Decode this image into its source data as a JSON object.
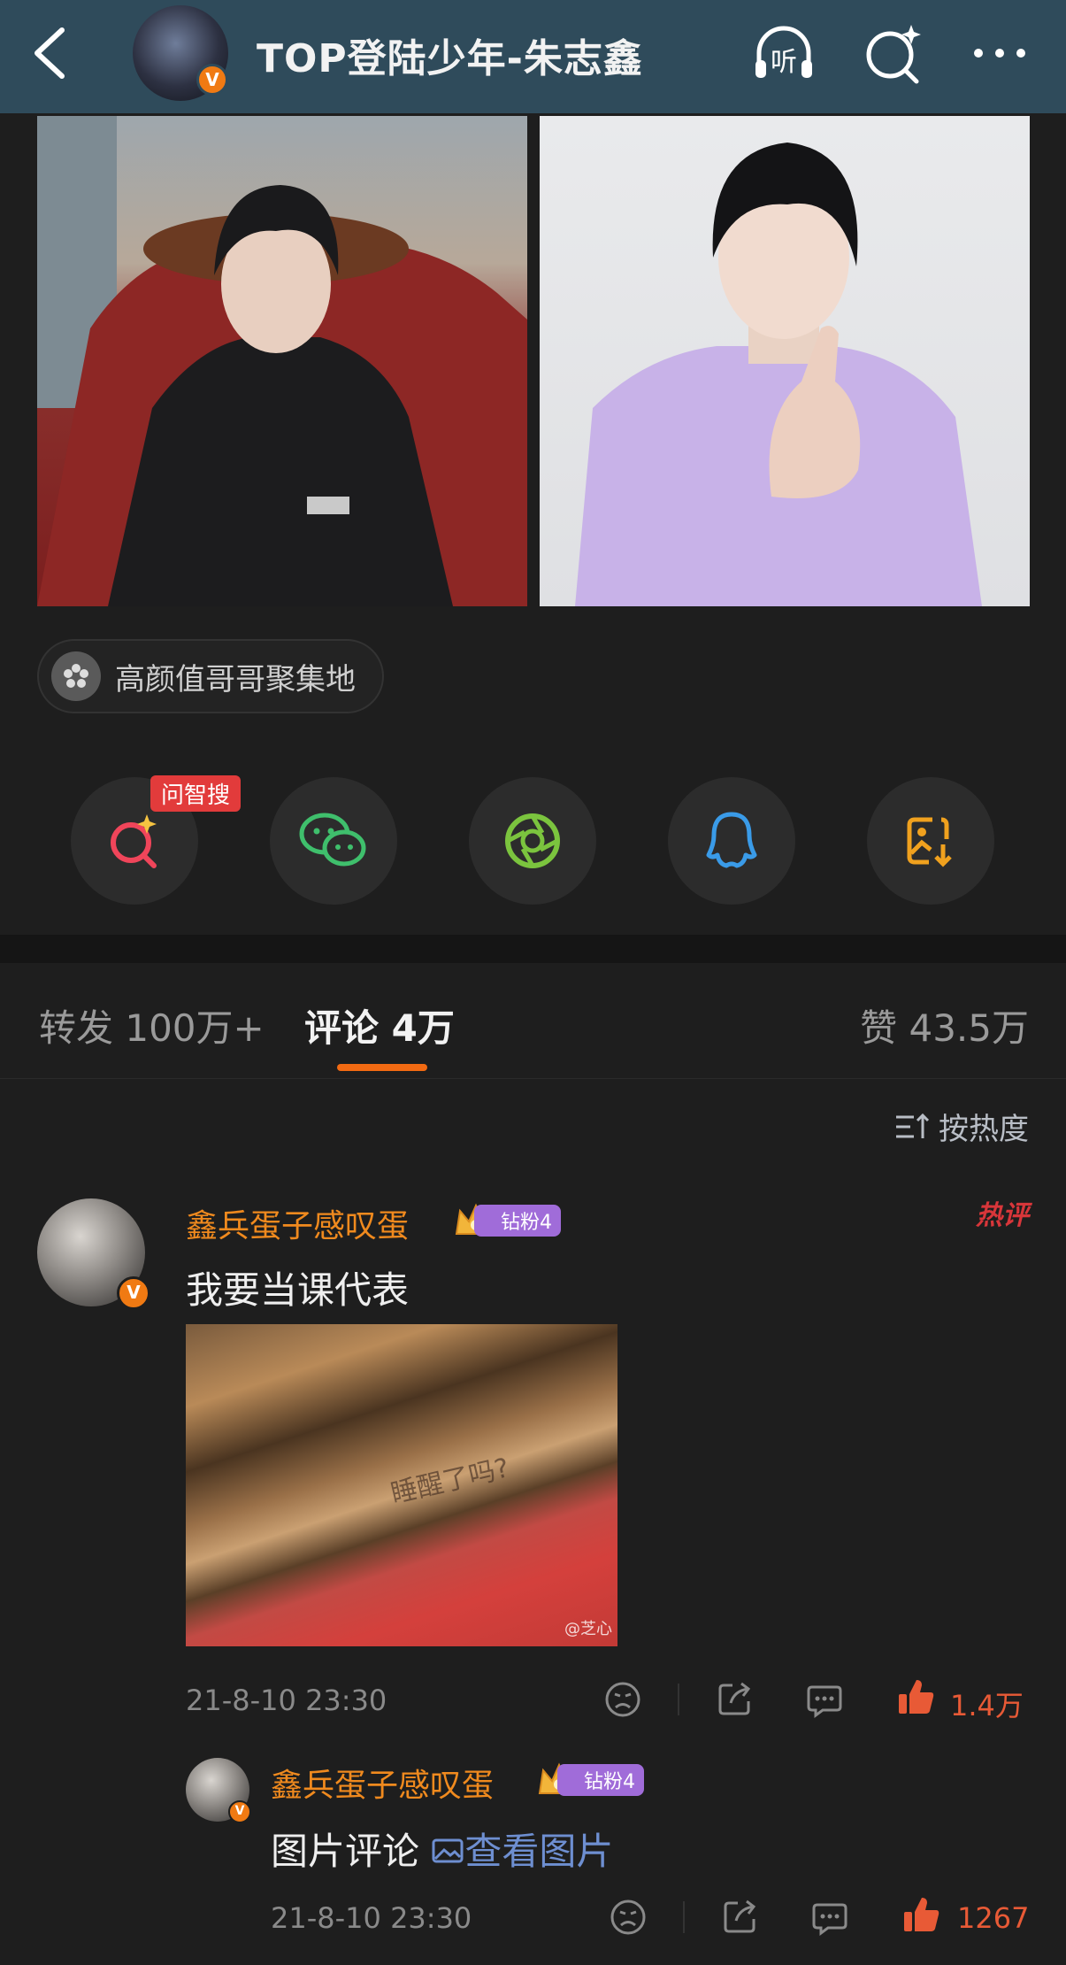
{
  "header": {
    "title": "TOP登陆少年-朱志鑫",
    "listen_label": "听"
  },
  "topic": {
    "label": "高颜值哥哥聚集地"
  },
  "share": {
    "ai_search_tag": "问智搜",
    "items": [
      "ai-search",
      "wechat",
      "moments",
      "qq",
      "save-image"
    ]
  },
  "tabs": {
    "repost": "转发 100万+",
    "comment": "评论 4万",
    "like": "赞 43.5万"
  },
  "sort": {
    "label": "按热度"
  },
  "comments": [
    {
      "user": "鑫兵蛋子感叹蛋",
      "badge": "钻粉4",
      "hot_tag": "热评",
      "text": "我要当课代表",
      "image_text": "睡醒了吗?",
      "image_watermark": "@芝心",
      "time": "21-8-10 23:30",
      "likes": "1.4万"
    }
  ],
  "reply": {
    "user": "鑫兵蛋子感叹蛋",
    "badge": "钻粉4",
    "text": "图片评论",
    "link": "查看图片",
    "time": "21-8-10 23:30",
    "likes": "1267"
  },
  "colors": {
    "topbar": "#2f4b5b",
    "accent": "#f26a12",
    "username": "#f08a1e",
    "like": "#e85a36",
    "badge": "#a06cd9"
  }
}
